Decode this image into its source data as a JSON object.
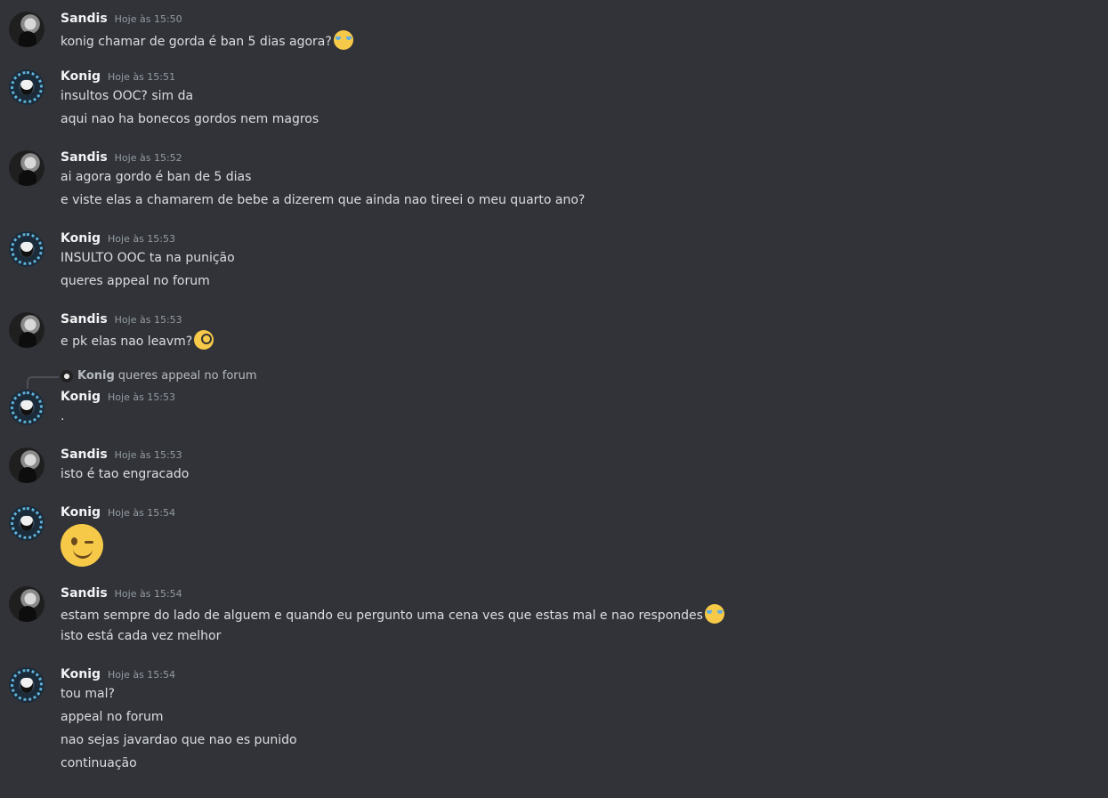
{
  "messages": [
    {
      "author": "Sandis",
      "time": "Hoje às 15:50",
      "lines": [
        "konig chamar de gorda é ban 5 dias agora?"
      ],
      "emoji": "joy-emoji"
    },
    {
      "author": "Konig",
      "time": "Hoje às 15:51",
      "lines": [
        "insultos OOC? sim da",
        "aqui nao ha bonecos gordos nem magros"
      ]
    },
    {
      "author": "Sandis",
      "time": "Hoje às 15:52",
      "lines": [
        "ai agora gordo é ban de 5 dias",
        "e viste elas a chamarem de bebe a dizerem que ainda nao tireei o meu quarto ano?"
      ]
    },
    {
      "author": "Konig",
      "time": "Hoje às 15:53",
      "lines": [
        "INSULTO OOC ta na punição",
        "queres appeal no forum"
      ]
    },
    {
      "author": "Sandis",
      "time": "Hoje às 15:53",
      "lines": [
        "e pk elas nao leavm?"
      ],
      "emoji": "face-with-monocle-emoji"
    },
    {
      "author": "Konig",
      "time": "Hoje às 15:53",
      "lines": [
        "."
      ],
      "reply": {
        "author": "Konig",
        "text": "queres appeal no forum"
      }
    },
    {
      "author": "Sandis",
      "time": "Hoje às 15:53",
      "lines": [
        "isto é tao engracado"
      ]
    },
    {
      "author": "Konig",
      "time": "Hoje às 15:54",
      "lines": [],
      "big_emoji": "winking-face-emoji"
    },
    {
      "author": "Sandis",
      "time": "Hoje às 15:54",
      "lines": [
        "estam sempre do lado de alguem e quando eu pergunto uma cena ves que estas mal e nao respondes",
        "isto está cada vez melhor"
      ],
      "emoji": "joy-emoji"
    },
    {
      "author": "Konig",
      "time": "Hoje às 15:54",
      "lines": [
        "tou mal?",
        "appeal no forum",
        "nao sejas javardao que nao es punido",
        "continuação"
      ]
    }
  ]
}
